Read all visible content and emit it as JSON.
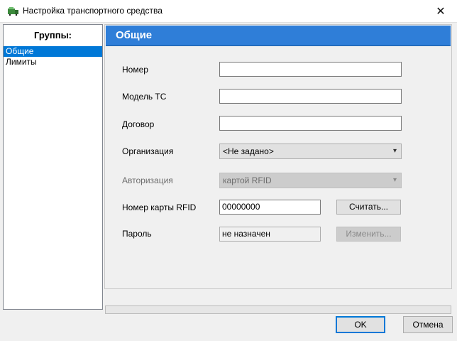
{
  "window": {
    "title": "Настройка транспортного средства",
    "close_glyph": "✕"
  },
  "groups": {
    "header": "Группы:",
    "items": [
      {
        "label": "Общие",
        "selected": true
      },
      {
        "label": "Лимиты",
        "selected": false
      }
    ]
  },
  "section": {
    "title": "Общие"
  },
  "form": {
    "number": {
      "label": "Номер",
      "value": ""
    },
    "model": {
      "label": "Модель ТС",
      "value": ""
    },
    "contract": {
      "label": "Договор",
      "value": ""
    },
    "organization": {
      "label": "Организация",
      "value": "<Не задано>"
    },
    "authorization": {
      "label": "Авторизация",
      "value": "картой RFID",
      "disabled": true
    },
    "rfid": {
      "label": "Номер карты RFID",
      "value": "00000000",
      "button": "Считать..."
    },
    "password": {
      "label": "Пароль",
      "value": "не назначен",
      "button": "Изменить...",
      "button_disabled": true
    }
  },
  "footer": {
    "ok_label": "OK",
    "cancel_label": "Отмена"
  },
  "colors": {
    "accent": "#0078d7",
    "section_header": "#2f7ed8"
  }
}
